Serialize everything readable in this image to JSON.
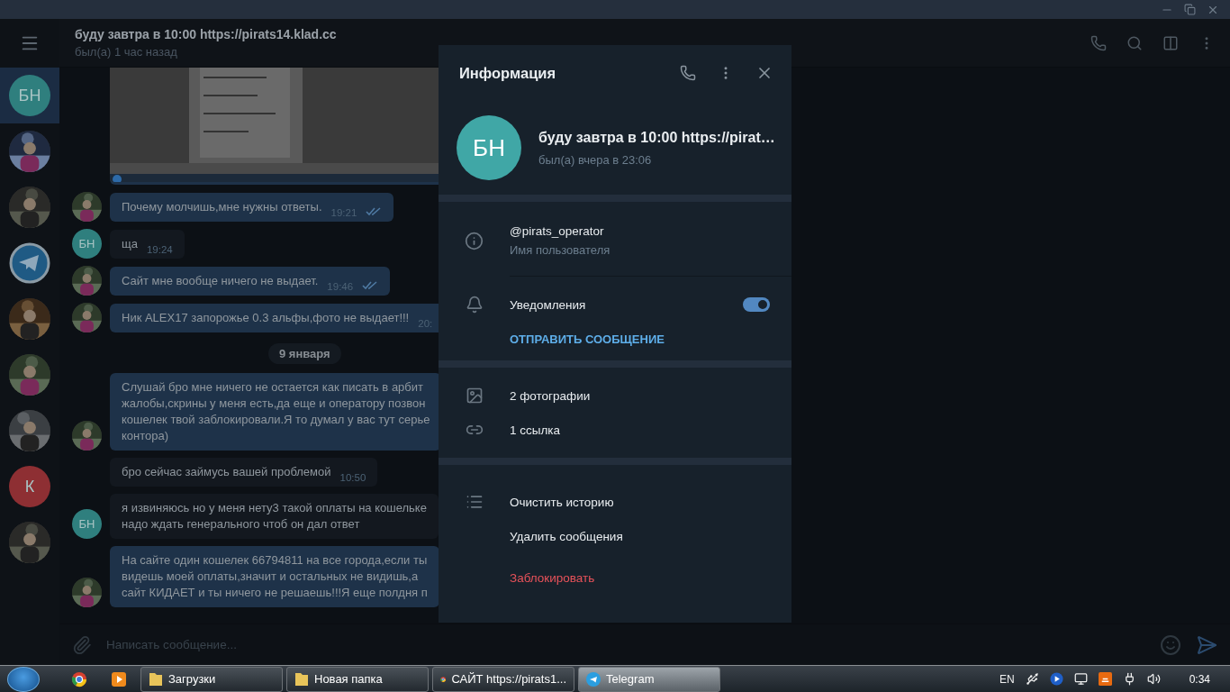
{
  "header": {
    "title": "буду завтра в 10:00 https://pirats14.klad.cc",
    "status": "был(а) 1 час назад"
  },
  "sidebar": {
    "chats": [
      {
        "kind": "initials",
        "initials": "БН",
        "color": "#2f7f7e",
        "selected": true
      },
      {
        "kind": "picture",
        "selected": false
      },
      {
        "kind": "picture",
        "selected": false
      },
      {
        "kind": "logo",
        "selected": false
      },
      {
        "kind": "picture",
        "selected": false
      },
      {
        "kind": "picture",
        "selected": false
      },
      {
        "kind": "picture",
        "selected": false
      },
      {
        "kind": "initials",
        "initials": "К",
        "color": "#8e2f33",
        "selected": false
      },
      {
        "kind": "picture",
        "selected": false
      }
    ]
  },
  "messages": [
    {
      "kind": "picture",
      "outgoing": true
    },
    {
      "kind": "text",
      "outgoing": true,
      "avatar": {
        "kind": "picture"
      },
      "lines": [
        "Почему молчишь,мне нужны ответы."
      ],
      "time": "19:21",
      "read": true
    },
    {
      "kind": "text",
      "outgoing": false,
      "avatar": {
        "kind": "initials",
        "text": "БН"
      },
      "lines": [
        "ща"
      ],
      "time": "19:24"
    },
    {
      "kind": "text",
      "outgoing": true,
      "avatar": {
        "kind": "picture"
      },
      "lines": [
        "Сайт мне вообще ничего не выдает."
      ],
      "time": "19:46",
      "read": true
    },
    {
      "kind": "text",
      "outgoing": true,
      "avatar": {
        "kind": "picture"
      },
      "lines": [
        "Ник ALEX17 запорожье 0.3 альфы,фото не выдает!!!"
      ],
      "time": "20:"
    },
    {
      "kind": "date",
      "text": "9 января"
    },
    {
      "kind": "text",
      "outgoing": true,
      "avatar": {
        "kind": "picture"
      },
      "lines": [
        "Слушай бро мне ничего не остается как писать в арбит",
        "жалобы,скрины у меня есть,да еще и оператору позвон",
        "кошелек твой заблокировали.Я то думал у вас тут серье",
        "контора)"
      ]
    },
    {
      "kind": "text",
      "outgoing": false,
      "lines": [
        "бро сейчас займусь вашей проблемой"
      ],
      "time": "10:50"
    },
    {
      "kind": "text",
      "outgoing": false,
      "avatar": {
        "kind": "initials",
        "text": "БН"
      },
      "lines": [
        "я извиняюсь но у меня нету3 такой оплаты на кошельке",
        "надо ждать генерального чтоб он дал ответ"
      ]
    },
    {
      "kind": "text",
      "outgoing": true,
      "avatar": {
        "kind": "picture"
      },
      "lines": [
        "На сайте один кошелек 66794811 на все города,если ты",
        "видешь  моей оплаты,значит и остальных не видишь,а",
        "сайт КИДАЕТ и ты ничего не решаешь!!!Я еще полдня п"
      ]
    }
  ],
  "composer": {
    "placeholder": "Написать сообщение..."
  },
  "info": {
    "title": "Информация",
    "profile": {
      "initials": "БН",
      "name": "буду завтра в 10:00 https://pirat…",
      "status": "был(а) вчера в 23:06"
    },
    "username": {
      "value": "@pirats_operator",
      "label": "Имя пользователя"
    },
    "notifications": {
      "label": "Уведомления",
      "on": true
    },
    "send_button": "ОТПРАВИТЬ СООБЩЕНИЕ",
    "media": [
      {
        "kind": "photos",
        "label": "2 фотографии"
      },
      {
        "kind": "links",
        "label": "1 ссылка"
      }
    ],
    "actions": [
      {
        "kind": "normal",
        "label": "Очистить историю"
      },
      {
        "kind": "normal",
        "label": "Удалить сообщения"
      },
      {
        "kind": "danger",
        "label": "Заблокировать"
      }
    ]
  },
  "taskbar": {
    "pinned": [
      {
        "kind": "chrome"
      },
      {
        "kind": "media"
      }
    ],
    "windows": [
      {
        "kind": "folder",
        "label": "Загрузки",
        "selected": false
      },
      {
        "kind": "folder",
        "label": "Новая папка",
        "selected": false
      },
      {
        "kind": "chrome",
        "label": "САЙТ https://pirats1...",
        "selected": false
      },
      {
        "kind": "telegram",
        "label": "Telegram",
        "selected": true
      }
    ],
    "language": "EN",
    "time": "0:34"
  }
}
